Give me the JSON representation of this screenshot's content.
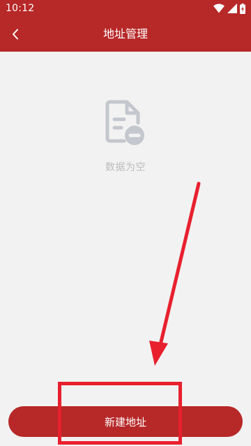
{
  "status_bar": {
    "time": "10:12",
    "icons": [
      "wifi-icon",
      "cellular-signal-icon",
      "battery-icon"
    ]
  },
  "app_bar": {
    "back_icon": "chevron-left-icon",
    "title": "地址管理"
  },
  "empty_state": {
    "icon": "document-remove-icon",
    "message": "数据为空"
  },
  "footer": {
    "add_button_label": "新建地址"
  },
  "colors": {
    "primary": "#b72828",
    "background": "#f2f2f2",
    "empty_text": "#bcbcbc",
    "empty_icon": "#c4c7cd",
    "annotation": "#e8202e"
  }
}
